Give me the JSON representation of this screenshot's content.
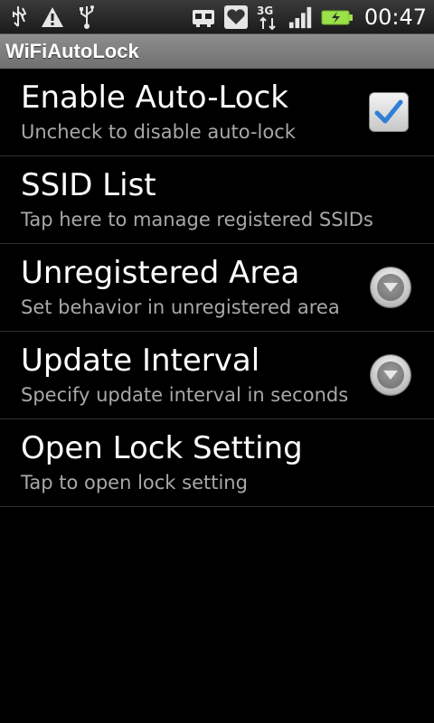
{
  "status_bar": {
    "left_icons": [
      "usb-debug-icon",
      "warning-icon",
      "usb-icon"
    ],
    "right_icons": [
      "robot-icon",
      "heart-icon",
      "3g-data-icon",
      "signal-icon",
      "battery-charging-icon"
    ],
    "network_label": "3G",
    "time": "00:47"
  },
  "app": {
    "title": "WiFiAutoLock"
  },
  "settings": [
    {
      "title": "Enable Auto-Lock",
      "summary": "Uncheck to disable auto-lock",
      "widget": "checkbox",
      "checked": true
    },
    {
      "title": "SSID List",
      "summary": "Tap here to manage registered SSIDs",
      "widget": "none"
    },
    {
      "title": "Unregistered Area",
      "summary": "Set behavior in unregistered area",
      "widget": "dropdown"
    },
    {
      "title": "Update Interval",
      "summary": "Specify update interval in seconds",
      "widget": "dropdown"
    },
    {
      "title": "Open Lock Setting",
      "summary": "Tap to open lock setting",
      "widget": "none"
    }
  ],
  "colors": {
    "background": "#000000",
    "title_bar": "#7f7f7f",
    "checkbox_check": "#2f7ed8",
    "battery": "#9be14a"
  }
}
